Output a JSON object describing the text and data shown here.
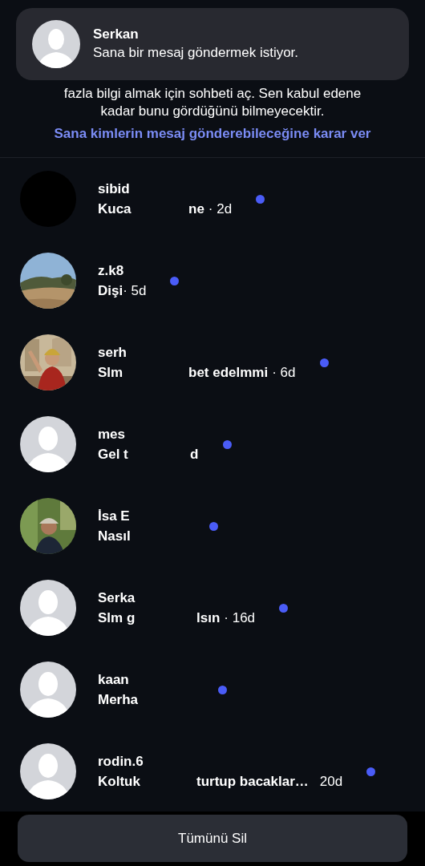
{
  "notification": {
    "sender": "Serkan",
    "message": "Sana bir mesaj göndermek istiyor."
  },
  "info": {
    "text": "fazla bilgi almak için sohbeti aç. Sen kabul edene kadar bunu gördüğünü bilmeyecektir.",
    "link": "Sana kimlerin mesaj gönderebileceğine karar ver"
  },
  "requests": [
    {
      "kind": "dark",
      "name": "sibid",
      "preview_start": "Kuca",
      "preview_end": "ne",
      "time": "· 2d",
      "unread": true
    },
    {
      "name": "z.k8",
      "preview_start": "Dişi",
      "time": "· 5d",
      "unread": true
    },
    {
      "name": "serh",
      "preview_start": "Slm",
      "preview_end": "bet edelmmi",
      "time": "· 6d",
      "unread": true
    },
    {
      "kind": "default",
      "name": "mes",
      "preview_start": "Gel t",
      "preview_end": "d",
      "unread": true
    },
    {
      "name": "İsa E",
      "preview_start": "Nasıl",
      "unread": true
    },
    {
      "kind": "default",
      "name": "Serka",
      "preview_start": "Slm g",
      "preview_end": "lsın",
      "time": "· 16d",
      "unread": true
    },
    {
      "kind": "default",
      "name": "kaan",
      "preview_start": "Merha",
      "unread": true
    },
    {
      "kind": "default",
      "name": "rodin.6",
      "preview_start": "Koltuk",
      "preview_end": "turtup bacaklar…",
      "time": "20d",
      "unread": true
    }
  ],
  "delete_all_button": "Tümünü Sil"
}
